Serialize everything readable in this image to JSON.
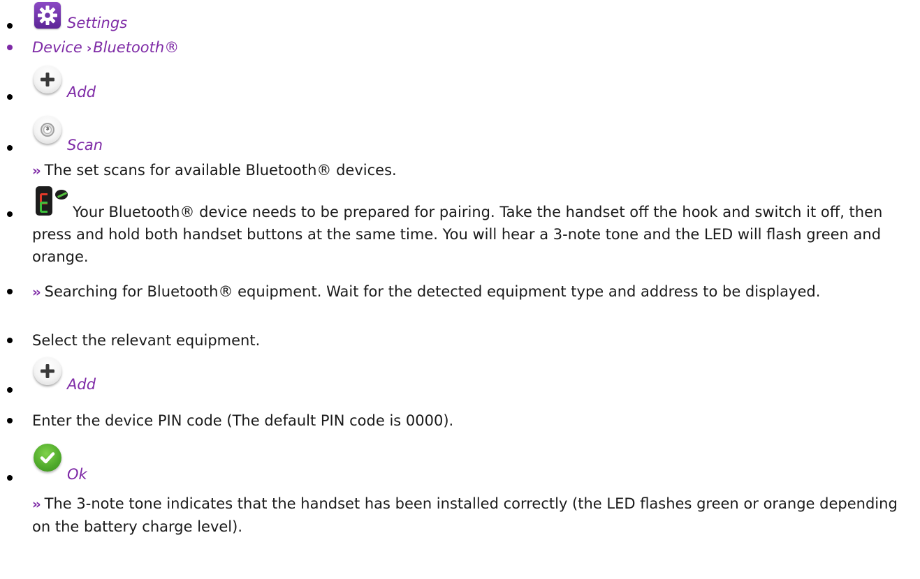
{
  "steps": {
    "settings": {
      "label": "Settings",
      "icon": "gear-icon"
    },
    "path": {
      "part1": "Device",
      "separator": "›",
      "part2": "Bluetooth®"
    },
    "add1": {
      "label": "Add",
      "icon": "plus-icon"
    },
    "scan": {
      "label": "Scan",
      "icon": "bluetooth-scan-icon",
      "result_prefix": "››",
      "result": "The set scans for available Bluetooth® devices."
    },
    "prepare": {
      "icon": "handset-icon",
      "text": "Your Bluetooth® device needs to be prepared for pairing. Take the handset off the hook and switch it off, then press and hold both handset buttons at the same time. You will hear a 3-note tone and the LED will flash green and orange."
    },
    "searching": {
      "prefix": "››",
      "text": "Searching for Bluetooth® equipment. Wait for the detected equipment type and address to be displayed."
    },
    "select": {
      "text": "Select the relevant equipment."
    },
    "add2": {
      "label": "Add",
      "icon": "plus-icon"
    },
    "pin": {
      "text": "Enter the device PIN code (The default PIN code is 0000)."
    },
    "ok": {
      "label": "Ok",
      "icon": "check-icon",
      "result_prefix": "››",
      "result": "The 3-note tone indicates that the handset has been installed correctly (the LED flashes green or orange depending on the battery charge level)."
    }
  },
  "colors": {
    "accent": "#7e2aa6",
    "ok_green": "#4ea92a"
  }
}
